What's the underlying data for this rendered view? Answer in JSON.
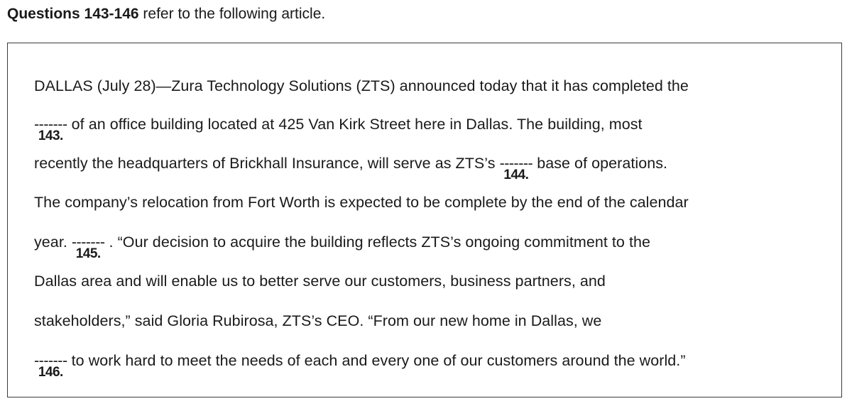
{
  "header": {
    "bold": "Questions 143-146",
    "rest": " refer to the following article."
  },
  "blank_text": "-------",
  "article": {
    "l1": "DALLAS (July 28)—Zura Technology Solutions (ZTS) announced today that it has completed the",
    "l2_after": " of an office building located at 425 Van Kirk Street here in Dallas. The building, most",
    "l3_before": "recently the headquarters of Brickhall Insurance, will serve as ZTS’s ",
    "l3_after": " base of operations.",
    "l4": "The company’s relocation from Fort Worth is expected to be complete by the end of the calendar",
    "l5_before": "year. ",
    "l5_after": " . “Our decision to acquire the building reflects ZTS’s ongoing commitment to the",
    "l6": "Dallas area and will enable us to better serve our customers, business partners, and",
    "l7": "stakeholders,” said Gloria Rubirosa, ZTS’s CEO. “From our new home in Dallas, we",
    "l8_after": " to work hard to meet the needs of each and every one of our customers around the world.”"
  },
  "question_numbers": {
    "q143": "143.",
    "q144": "144.",
    "q145": "145.",
    "q146": "146."
  }
}
